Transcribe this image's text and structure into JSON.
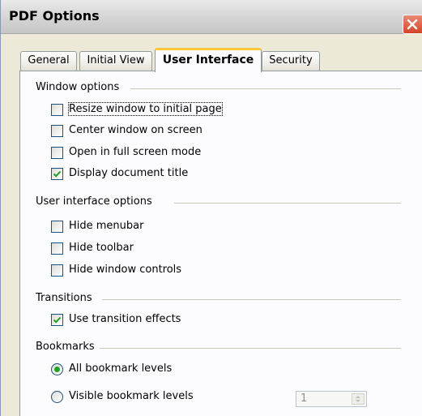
{
  "window": {
    "title": "PDF Options"
  },
  "tabs": [
    "General",
    "Initial View",
    "User Interface",
    "Security"
  ],
  "active_tab": "User Interface",
  "sections": {
    "window_options": {
      "label": "Window options",
      "items": [
        {
          "label": "Resize window to initial page",
          "checked": false
        },
        {
          "label": "Center window on screen",
          "checked": false
        },
        {
          "label": "Open in full screen mode",
          "checked": false
        },
        {
          "label": "Display document title",
          "checked": true
        }
      ]
    },
    "ui_options": {
      "label": "User interface options",
      "items": [
        {
          "label": "Hide menubar",
          "checked": false
        },
        {
          "label": "Hide toolbar",
          "checked": false
        },
        {
          "label": "Hide window controls",
          "checked": false
        }
      ]
    },
    "transitions": {
      "label": "Transitions",
      "items": [
        {
          "label": "Use transition effects",
          "checked": true
        }
      ]
    },
    "bookmarks": {
      "label": "Bookmarks",
      "items": [
        {
          "label": "All bookmark levels",
          "selected": true
        },
        {
          "label": "Visible bookmark levels",
          "selected": false
        }
      ],
      "level_value": "1"
    }
  },
  "colors": {
    "accent_tab": "#ffc83c",
    "check": "#21a121",
    "close": "#d1452b"
  }
}
